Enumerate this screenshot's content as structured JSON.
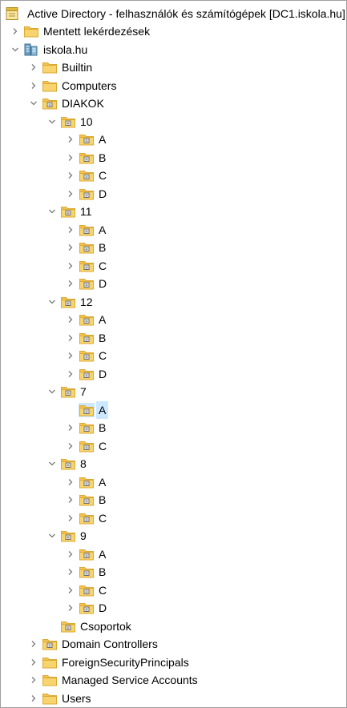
{
  "title_row": {
    "label": "Active Directory - felhasználók és számítógépek [DC1.iskola.hu]",
    "icon": "ad-console-icon"
  },
  "tree": [
    {
      "label": "Mentett lekérdezések",
      "level": 0,
      "toggle": "collapsed",
      "icon": "folder-icon"
    },
    {
      "label": "iskola.hu",
      "level": 0,
      "toggle": "expanded",
      "icon": "domain-icon"
    },
    {
      "label": "Builtin",
      "level": 1,
      "toggle": "collapsed",
      "icon": "folder-icon"
    },
    {
      "label": "Computers",
      "level": 1,
      "toggle": "collapsed",
      "icon": "folder-icon"
    },
    {
      "label": "DIAKOK",
      "level": 1,
      "toggle": "expanded",
      "icon": "ou-icon"
    },
    {
      "label": "10",
      "level": 2,
      "toggle": "expanded",
      "icon": "ou-icon"
    },
    {
      "label": "A",
      "level": 3,
      "toggle": "collapsed",
      "icon": "ou-icon"
    },
    {
      "label": "B",
      "level": 3,
      "toggle": "collapsed",
      "icon": "ou-icon"
    },
    {
      "label": "C",
      "level": 3,
      "toggle": "collapsed",
      "icon": "ou-icon"
    },
    {
      "label": "D",
      "level": 3,
      "toggle": "collapsed",
      "icon": "ou-icon"
    },
    {
      "label": "11",
      "level": 2,
      "toggle": "expanded",
      "icon": "ou-icon"
    },
    {
      "label": "A",
      "level": 3,
      "toggle": "collapsed",
      "icon": "ou-icon"
    },
    {
      "label": "B",
      "level": 3,
      "toggle": "collapsed",
      "icon": "ou-icon"
    },
    {
      "label": "C",
      "level": 3,
      "toggle": "collapsed",
      "icon": "ou-icon"
    },
    {
      "label": "D",
      "level": 3,
      "toggle": "collapsed",
      "icon": "ou-icon"
    },
    {
      "label": "12",
      "level": 2,
      "toggle": "expanded",
      "icon": "ou-icon"
    },
    {
      "label": "A",
      "level": 3,
      "toggle": "collapsed",
      "icon": "ou-icon"
    },
    {
      "label": "B",
      "level": 3,
      "toggle": "collapsed",
      "icon": "ou-icon"
    },
    {
      "label": "C",
      "level": 3,
      "toggle": "collapsed",
      "icon": "ou-icon"
    },
    {
      "label": "D",
      "level": 3,
      "toggle": "collapsed",
      "icon": "ou-icon"
    },
    {
      "label": "7",
      "level": 2,
      "toggle": "expanded",
      "icon": "ou-icon"
    },
    {
      "label": "A",
      "level": 3,
      "toggle": "none",
      "icon": "ou-icon",
      "selected": true
    },
    {
      "label": "B",
      "level": 3,
      "toggle": "collapsed",
      "icon": "ou-icon"
    },
    {
      "label": "C",
      "level": 3,
      "toggle": "collapsed",
      "icon": "ou-icon"
    },
    {
      "label": "8",
      "level": 2,
      "toggle": "expanded",
      "icon": "ou-icon"
    },
    {
      "label": "A",
      "level": 3,
      "toggle": "collapsed",
      "icon": "ou-icon"
    },
    {
      "label": "B",
      "level": 3,
      "toggle": "collapsed",
      "icon": "ou-icon"
    },
    {
      "label": "C",
      "level": 3,
      "toggle": "collapsed",
      "icon": "ou-icon"
    },
    {
      "label": "9",
      "level": 2,
      "toggle": "expanded",
      "icon": "ou-icon"
    },
    {
      "label": "A",
      "level": 3,
      "toggle": "collapsed",
      "icon": "ou-icon"
    },
    {
      "label": "B",
      "level": 3,
      "toggle": "collapsed",
      "icon": "ou-icon"
    },
    {
      "label": "C",
      "level": 3,
      "toggle": "collapsed",
      "icon": "ou-icon"
    },
    {
      "label": "D",
      "level": 3,
      "toggle": "collapsed",
      "icon": "ou-icon"
    },
    {
      "label": "Csoportok",
      "level": 2,
      "toggle": "none",
      "icon": "ou-icon"
    },
    {
      "label": "Domain Controllers",
      "level": 1,
      "toggle": "collapsed",
      "icon": "ou-icon"
    },
    {
      "label": "ForeignSecurityPrincipals",
      "level": 1,
      "toggle": "collapsed",
      "icon": "folder-icon"
    },
    {
      "label": "Managed Service Accounts",
      "level": 1,
      "toggle": "collapsed",
      "icon": "folder-icon"
    },
    {
      "label": "Users",
      "level": 1,
      "toggle": "collapsed",
      "icon": "folder-icon"
    }
  ],
  "colors": {
    "selection": "#cce8ff",
    "folder": "#f3c24f",
    "folder_dark": "#dca934",
    "toggle": "#7a7a7a"
  }
}
